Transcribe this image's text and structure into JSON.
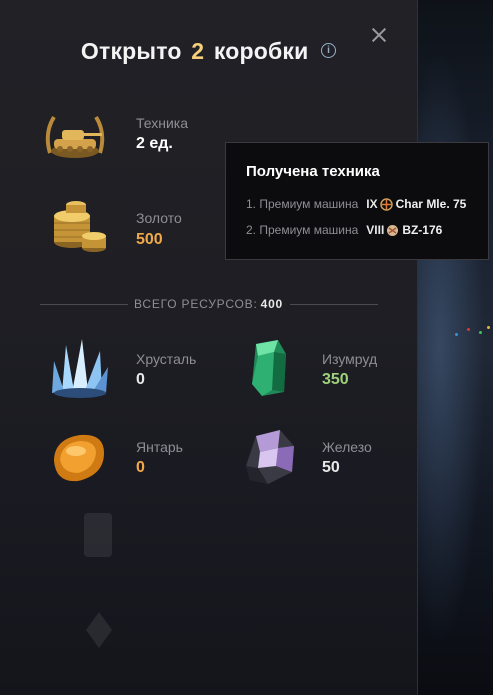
{
  "header": {
    "title_prefix": "Открыто",
    "title_count": "2",
    "title_suffix": "коробки"
  },
  "rewards": {
    "vehicles": {
      "label": "Техника",
      "value": "2 ед.",
      "icon": "tank-emblem-icon"
    },
    "gold": {
      "label": "Золото",
      "value": "500",
      "icon": "gold-coins-icon"
    }
  },
  "resources_total": {
    "label": "ВСЕГО РЕСУРСОВ:",
    "value": "400"
  },
  "resources": [
    {
      "label": "Хрусталь",
      "value": "0",
      "icon": "crystal-icon",
      "value_color": "#e8e8e8"
    },
    {
      "label": "Изумруд",
      "value": "350",
      "icon": "emerald-icon",
      "value_color": "#9fd17a"
    },
    {
      "label": "Янтарь",
      "value": "0",
      "icon": "amber-icon",
      "value_color": "#f0a94a"
    },
    {
      "label": "Железо",
      "value": "50",
      "icon": "iron-ore-icon",
      "value_color": "#e8e8e8"
    }
  ],
  "tooltip": {
    "title": "Получена техника",
    "items": [
      {
        "index": "1.",
        "type": "Премиум машина",
        "tier": "IX",
        "nation_icon": "france-flag-icon",
        "name": "Char Mle. 75"
      },
      {
        "index": "2.",
        "type": "Премиум машина",
        "tier": "VIII",
        "nation_icon": "ussr-flag-icon",
        "name": "BZ-176"
      }
    ]
  },
  "colors": {
    "accent_gold": "#f6cf7a",
    "gold_value": "#f0a94a",
    "emerald_value": "#9fd17a"
  }
}
